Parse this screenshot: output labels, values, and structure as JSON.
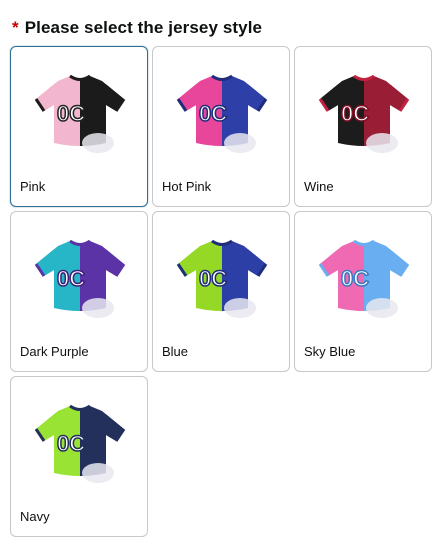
{
  "header": {
    "required_mark": "*",
    "title": "Please select the jersey style"
  },
  "options": [
    {
      "label": "Pink",
      "selected": true,
      "colors": {
        "left": "#f2b6cf",
        "right": "#1b1b1b",
        "sleeve": "#f2b6cf",
        "trim": "#1b1b1b",
        "numFill": "#ffffff",
        "numStroke": "#222222"
      }
    },
    {
      "label": "Hot Pink",
      "selected": false,
      "colors": {
        "left": "#e8469a",
        "right": "#2f3fa8",
        "sleeve": "#e8469a",
        "trim": "#1f2d7a",
        "numFill": "#ffffff",
        "numStroke": "#1f2d7a"
      }
    },
    {
      "label": "Wine",
      "selected": false,
      "colors": {
        "left": "#1c1c1c",
        "right": "#9a1d36",
        "sleeve": "#1c1c1c",
        "trim": "#c2213f",
        "numFill": "#ffffff",
        "numStroke": "#7a0f26"
      }
    },
    {
      "label": "Dark Purple",
      "selected": false,
      "colors": {
        "left": "#27b6c8",
        "right": "#5b33a6",
        "sleeve": "#27b6c8",
        "trim": "#5b33a6",
        "numFill": "#ffffff",
        "numStroke": "#3d1f7a"
      }
    },
    {
      "label": "Blue",
      "selected": false,
      "colors": {
        "left": "#95d926",
        "right": "#2b3fa6",
        "sleeve": "#95d926",
        "trim": "#1f2d7a",
        "numFill": "#ffffff",
        "numStroke": "#1f2d7a"
      }
    },
    {
      "label": "Sky Blue",
      "selected": false,
      "colors": {
        "left": "#ef6ab2",
        "right": "#69aef0",
        "sleeve": "#ef6ab2",
        "trim": "#69aef0",
        "numFill": "#ffffff",
        "numStroke": "#3b79c4"
      }
    },
    {
      "label": "Navy",
      "selected": false,
      "colors": {
        "left": "#98e334",
        "right": "#23305c",
        "sleeve": "#98e334",
        "trim": "#23305c",
        "numFill": "#ffffff",
        "numStroke": "#23305c"
      }
    }
  ]
}
